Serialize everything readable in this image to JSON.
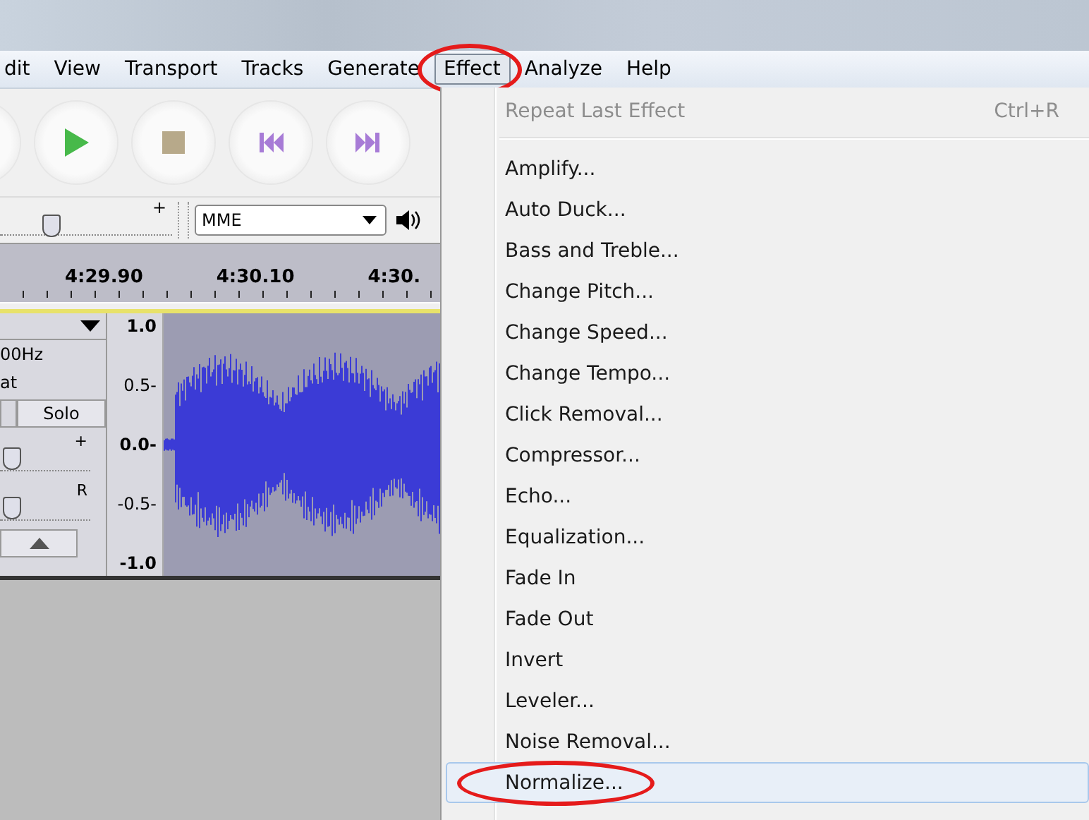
{
  "menu_bar": [
    {
      "label": "dit",
      "selected": false,
      "circled": false
    },
    {
      "label": "View",
      "selected": false,
      "circled": false
    },
    {
      "label": "Transport",
      "selected": false,
      "circled": false
    },
    {
      "label": "Tracks",
      "selected": false,
      "circled": false
    },
    {
      "label": "Generate",
      "selected": false,
      "circled": false
    },
    {
      "label": "Effect",
      "selected": true,
      "circled": true
    },
    {
      "label": "Analyze",
      "selected": false,
      "circled": false
    },
    {
      "label": "Help",
      "selected": false,
      "circled": false
    }
  ],
  "meter_toolbar": {
    "plus_label": "+",
    "level": 0.27,
    "device": "MME"
  },
  "ruler_labels": [
    "4:29.90",
    "4:30.10",
    "4:30."
  ],
  "track": {
    "rate": "00Hz",
    "format": "at",
    "solo": "Solo",
    "gain_label": "+",
    "gain": {
      "level": 0
    },
    "pan_label": "R",
    "pan": {
      "level": 0
    },
    "axis": [
      "1.0",
      "0.5-",
      "0.0-",
      "-0.5-",
      "-1.0"
    ]
  },
  "effect_menu": [
    {
      "kind": "command",
      "label": "Repeat Last Effect",
      "shortcut": "Ctrl+R",
      "disabled": true,
      "selected": false,
      "circled": false
    },
    {
      "kind": "separator"
    },
    {
      "kind": "command",
      "label": "Amplify...",
      "disabled": false,
      "selected": false,
      "circled": false
    },
    {
      "kind": "command",
      "label": "Auto Duck...",
      "disabled": false,
      "selected": false,
      "circled": false
    },
    {
      "kind": "command",
      "label": "Bass and Treble...",
      "disabled": false,
      "selected": false,
      "circled": false
    },
    {
      "kind": "command",
      "label": "Change Pitch...",
      "disabled": false,
      "selected": false,
      "circled": false
    },
    {
      "kind": "command",
      "label": "Change Speed...",
      "disabled": false,
      "selected": false,
      "circled": false
    },
    {
      "kind": "command",
      "label": "Change Tempo...",
      "disabled": false,
      "selected": false,
      "circled": false
    },
    {
      "kind": "command",
      "label": "Click Removal...",
      "disabled": false,
      "selected": false,
      "circled": false
    },
    {
      "kind": "command",
      "label": "Compressor...",
      "disabled": false,
      "selected": false,
      "circled": false
    },
    {
      "kind": "command",
      "label": "Echo...",
      "disabled": false,
      "selected": false,
      "circled": false
    },
    {
      "kind": "command",
      "label": "Equalization...",
      "disabled": false,
      "selected": false,
      "circled": false
    },
    {
      "kind": "command",
      "label": "Fade In",
      "disabled": false,
      "selected": false,
      "circled": false
    },
    {
      "kind": "command",
      "label": "Fade Out",
      "disabled": false,
      "selected": false,
      "circled": false
    },
    {
      "kind": "command",
      "label": "Invert",
      "disabled": false,
      "selected": false,
      "circled": false
    },
    {
      "kind": "command",
      "label": "Leveler...",
      "disabled": false,
      "selected": false,
      "circled": false
    },
    {
      "kind": "command",
      "label": "Noise Removal...",
      "disabled": false,
      "selected": false,
      "circled": false
    },
    {
      "kind": "command",
      "label": "Normalize...",
      "disabled": false,
      "selected": true,
      "circled": true
    }
  ]
}
